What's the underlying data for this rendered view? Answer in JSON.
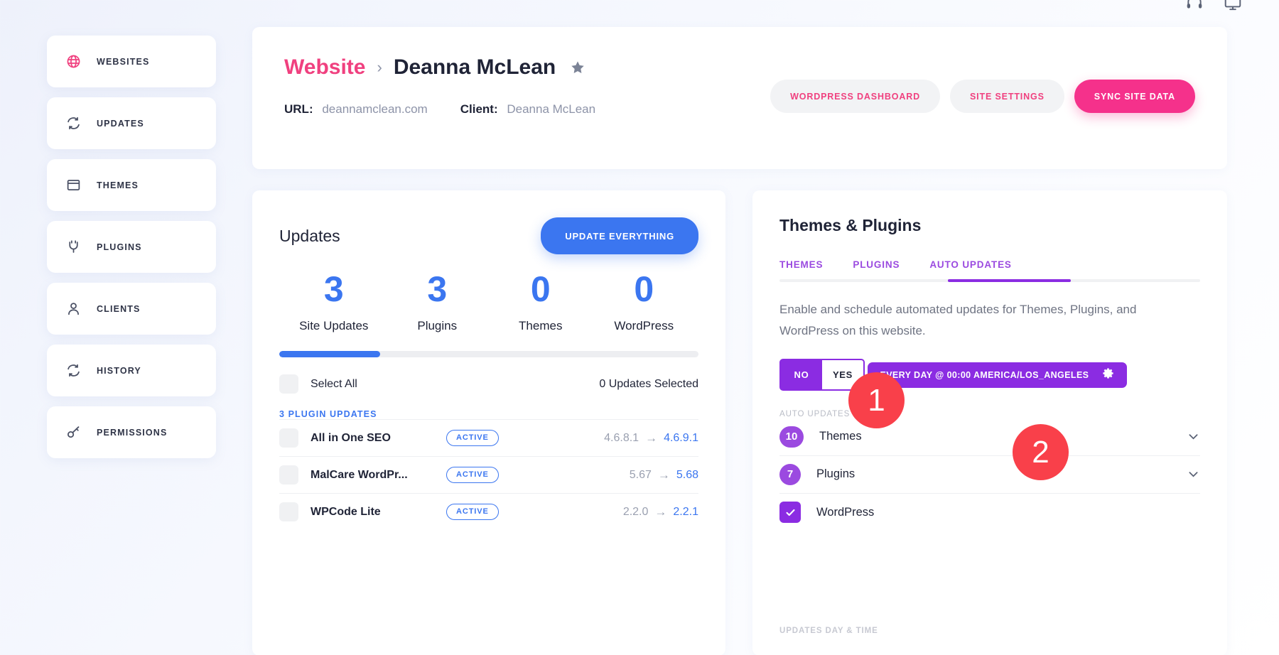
{
  "top_icons": [
    {
      "name": "support-icon"
    },
    {
      "name": "monitor-icon"
    }
  ],
  "sidebar": {
    "items": [
      {
        "label": "WEBSITES",
        "icon": "globe-icon",
        "active": true
      },
      {
        "label": "UPDATES",
        "icon": "refresh-icon",
        "active": false
      },
      {
        "label": "THEMES",
        "icon": "browser-window-icon",
        "active": false
      },
      {
        "label": "PLUGINS",
        "icon": "plug-icon",
        "active": false
      },
      {
        "label": "CLIENTS",
        "icon": "user-icon",
        "active": false
      },
      {
        "label": "HISTORY",
        "icon": "refresh-icon",
        "active": false
      },
      {
        "label": "PERMISSIONS",
        "icon": "key-icon",
        "active": false
      }
    ]
  },
  "header": {
    "breadcrumb_root": "Website",
    "breadcrumb_separator": "›",
    "breadcrumb_current": "Deanna McLean",
    "favorite_icon": "star-icon",
    "url_key": "URL:",
    "url_value": "deannamclean.com",
    "client_key": "Client:",
    "client_value": "Deanna McLean",
    "actions": [
      {
        "label": "WORDPRESS DASHBOARD",
        "style": "ghost"
      },
      {
        "label": "SITE SETTINGS",
        "style": "ghost"
      },
      {
        "label": "SYNC SITE DATA",
        "style": "primary"
      }
    ]
  },
  "updates": {
    "title": "Updates",
    "update_everything_label": "UPDATE EVERYTHING",
    "stats": [
      {
        "value": "3",
        "label": "Site Updates"
      },
      {
        "value": "3",
        "label": "Plugins"
      },
      {
        "value": "0",
        "label": "Themes"
      },
      {
        "value": "0",
        "label": "WordPress"
      }
    ],
    "progress_percent": 24,
    "select_all_label": "Select All",
    "selected_count_label": "0 Updates Selected",
    "group_heading": "3 PLUGIN UPDATES",
    "rows": [
      {
        "name": "All in One SEO",
        "status": "ACTIVE",
        "version_old": "4.6.8.1",
        "arrow": "→",
        "version_new": "4.6.9.1"
      },
      {
        "name": "MalCare WordPr...",
        "status": "ACTIVE",
        "version_old": "5.67",
        "arrow": "→",
        "version_new": "5.68"
      },
      {
        "name": "WPCode Lite",
        "status": "ACTIVE",
        "version_old": "2.2.0",
        "arrow": "→",
        "version_new": "2.2.1"
      }
    ]
  },
  "themes_plugins": {
    "title": "Themes & Plugins",
    "tabs": [
      {
        "label": "THEMES",
        "active": false
      },
      {
        "label": "PLUGINS",
        "active": false
      },
      {
        "label": "AUTO UPDATES",
        "active": true
      }
    ],
    "description": "Enable and schedule automated updates for Themes, Plugins, and WordPress on this website.",
    "toggle": {
      "no_label": "NO",
      "yes_label": "YES",
      "selected": "YES"
    },
    "schedule_field_label": "UPDATES DAY & TIME",
    "schedule_value": "EVERY DAY @ 00:00  AMERICA/LOS_ANGELES",
    "schedule_gear_icon": "gear-icon",
    "auto_updates_label": "AUTO UPDATES",
    "auto_update_rows": [
      {
        "count": "10",
        "name": "Themes",
        "control": "chevron-down-icon"
      },
      {
        "count": "7",
        "name": "Plugins",
        "control": "chevron-down-icon"
      },
      {
        "count": null,
        "name": "WordPress",
        "control": "checkbox-checked"
      }
    ]
  },
  "annotations": [
    {
      "id": "1",
      "label": "1"
    },
    {
      "id": "2",
      "label": "2"
    }
  ],
  "colors": {
    "brand_pink": "#f5318b",
    "accent_blue": "#3b76f0",
    "accent_purple": "#8b2ce2",
    "annotation_red": "#f9404a"
  }
}
